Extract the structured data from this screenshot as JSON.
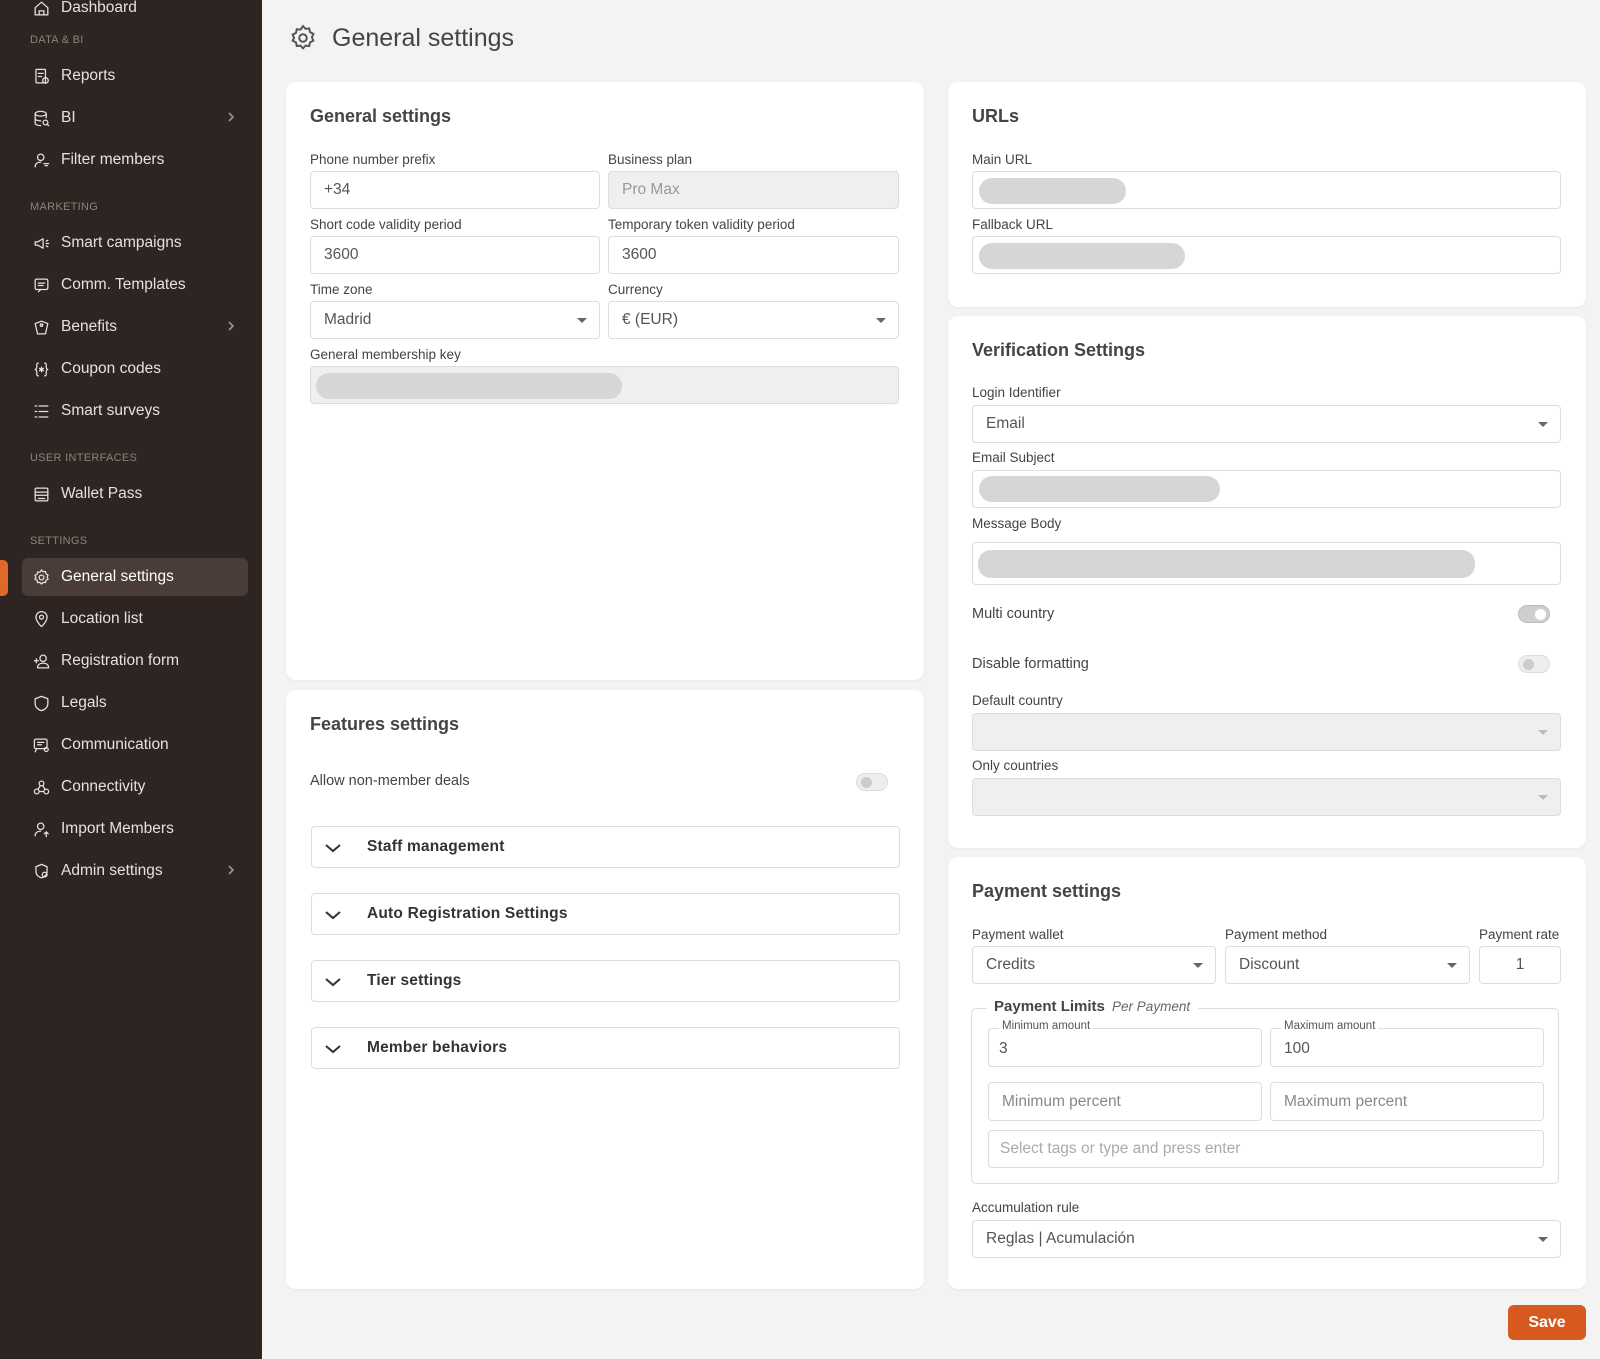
{
  "sidebar": {
    "top_item": "Dashboard",
    "sections": [
      {
        "title": "DATA & BI",
        "items": [
          {
            "label": "Reports",
            "icon": "reports-icon"
          },
          {
            "label": "BI",
            "icon": "database-icon",
            "expandable": true
          },
          {
            "label": "Filter members",
            "icon": "user-filter-icon"
          }
        ]
      },
      {
        "title": "MARKETING",
        "items": [
          {
            "label": "Smart campaigns",
            "icon": "megaphone-icon"
          },
          {
            "label": "Comm. Templates",
            "icon": "message-icon"
          },
          {
            "label": "Benefits",
            "icon": "tag-icon",
            "expandable": true
          },
          {
            "label": "Coupon codes",
            "icon": "braces-icon"
          },
          {
            "label": "Smart surveys",
            "icon": "list-icon"
          }
        ]
      },
      {
        "title": "USER INTERFACES",
        "items": [
          {
            "label": "Wallet Pass",
            "icon": "wallet-icon"
          }
        ]
      },
      {
        "title": "SETTINGS",
        "items": [
          {
            "label": "General settings",
            "icon": "gear-icon",
            "active": true
          },
          {
            "label": "Location list",
            "icon": "location-pin-icon"
          },
          {
            "label": "Registration form",
            "icon": "user-add-icon"
          },
          {
            "label": "Legals",
            "icon": "shield-icon"
          },
          {
            "label": "Communication",
            "icon": "chat-settings-icon"
          },
          {
            "label": "Connectivity",
            "icon": "connectivity-icon"
          },
          {
            "label": "Import Members",
            "icon": "user-import-icon"
          },
          {
            "label": "Admin settings",
            "icon": "admin-icon",
            "expandable": true
          }
        ]
      }
    ],
    "accent_color": "#e0692a"
  },
  "header": {
    "title": "General settings",
    "icon": "gear-icon"
  },
  "general": {
    "title": "General settings",
    "phone_prefix_label": "Phone number prefix",
    "phone_prefix_value": "+34",
    "business_plan_label": "Business plan",
    "business_plan_value": "Pro Max",
    "short_code_label": "Short code validity period",
    "short_code_value": "3600",
    "temp_token_label": "Temporary token validity period",
    "temp_token_value": "3600",
    "timezone_label": "Time zone",
    "timezone_value": "Madrid",
    "currency_label": "Currency",
    "currency_value": "€ (EUR)",
    "membership_key_label": "General membership key"
  },
  "features": {
    "title": "Features settings",
    "allow_non_member_label": "Allow non-member deals",
    "allow_non_member_on": false,
    "accordions": [
      "Staff management",
      "Auto Registration Settings",
      "Tier settings",
      "Member behaviors"
    ]
  },
  "urls": {
    "title": "URLs",
    "main_url_label": "Main URL",
    "fallback_url_label": "Fallback URL"
  },
  "verification": {
    "title": "Verification Settings",
    "login_identifier_label": "Login Identifier",
    "login_identifier_value": "Email",
    "email_subject_label": "Email Subject",
    "message_body_label": "Message Body",
    "multi_country_label": "Multi country",
    "multi_country_on": true,
    "disable_formatting_label": "Disable formatting",
    "disable_formatting_on": false,
    "default_country_label": "Default country",
    "only_countries_label": "Only countries"
  },
  "payment": {
    "title": "Payment settings",
    "wallet_label": "Payment wallet",
    "wallet_value": "Credits",
    "method_label": "Payment method",
    "method_value": "Discount",
    "rate_label": "Payment rate",
    "rate_value": "1",
    "limits_title": "Payment Limits",
    "limits_subtitle": "Per Payment",
    "min_amount_label": "Minimum amount",
    "min_amount_value": "3",
    "max_amount_label": "Maximum amount",
    "max_amount_value": "100",
    "min_percent_placeholder": "Minimum percent",
    "max_percent_placeholder": "Maximum percent",
    "tags_placeholder": "Select tags or type and press enter",
    "accumulation_label": "Accumulation rule",
    "accumulation_value": "Reglas | Acumulación"
  },
  "save_label": "Save"
}
